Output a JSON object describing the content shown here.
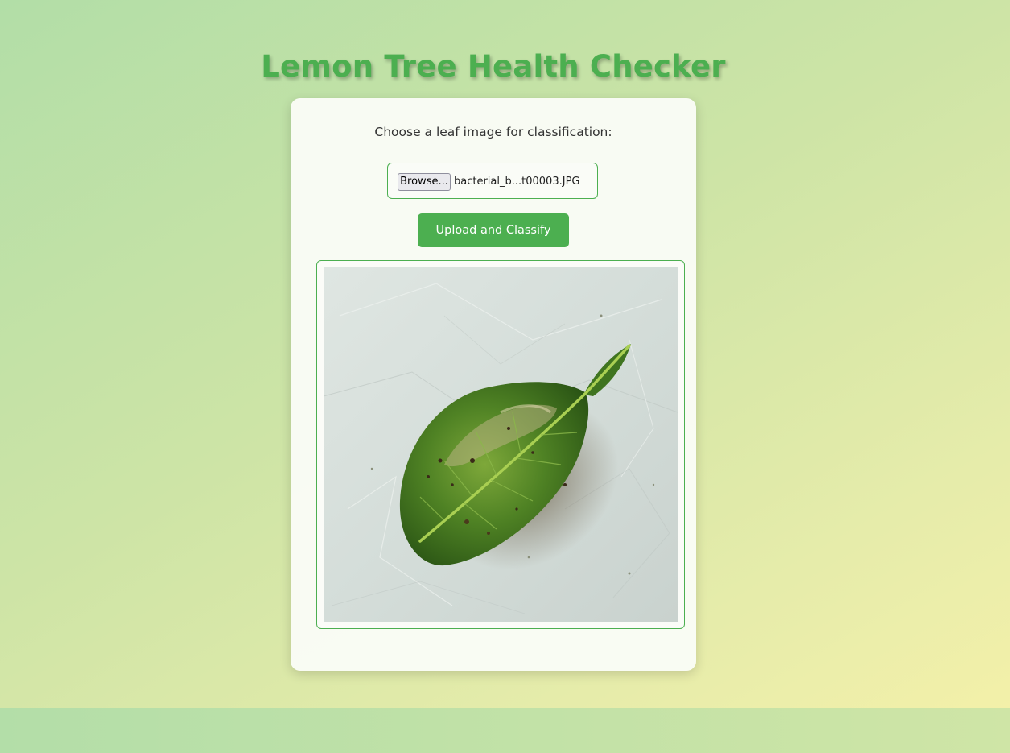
{
  "page": {
    "title": "Lemon Tree Health Checker"
  },
  "form": {
    "prompt": "Choose a leaf image for classification:",
    "file_input": {
      "button_label": "Browse...",
      "selected_file": "bacterial_b...t00003.JPG"
    },
    "submit_label": "Upload and Classify"
  },
  "preview": {
    "subject": "leaf-photo"
  },
  "colors": {
    "accent": "#4caf50",
    "card_background": "#fafcf6",
    "text": "#333333"
  }
}
